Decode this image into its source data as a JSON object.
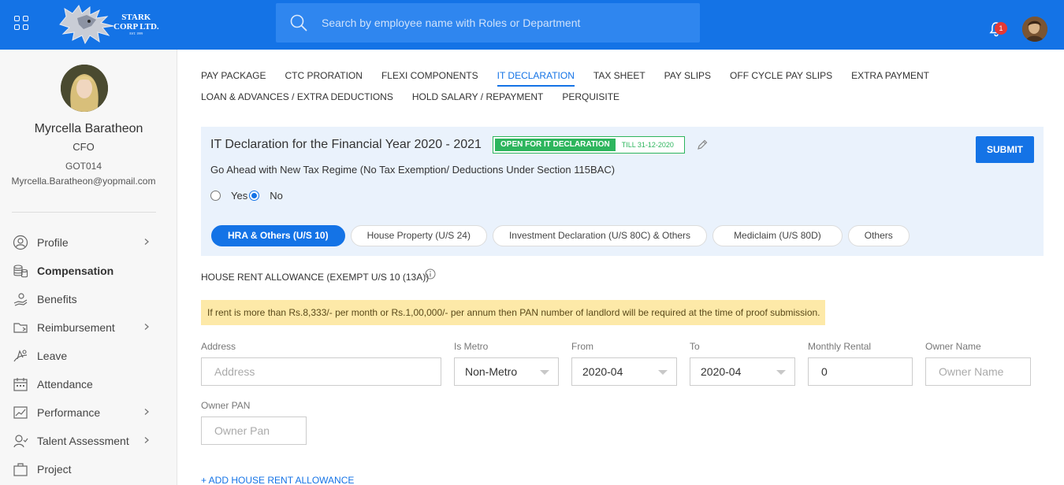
{
  "header": {
    "logo": {
      "line1": "STARK",
      "line2": "CORP LTD.",
      "est": "EST. 1999"
    },
    "search": {
      "placeholder": "Search by employee name with Roles or Department"
    },
    "notifications": {
      "count": "1"
    }
  },
  "profile": {
    "name": "Myrcella Baratheon",
    "role": "CFO",
    "code": "GOT014",
    "email": "Myrcella.Baratheon@yopmail.com"
  },
  "sidebar": {
    "items": [
      {
        "label": "Profile",
        "icon": "user-icon",
        "chevron": true
      },
      {
        "label": "Compensation",
        "icon": "coins-icon",
        "chevron": false,
        "active": true
      },
      {
        "label": "Benefits",
        "icon": "benefits-icon",
        "chevron": false
      },
      {
        "label": "Reimbursement",
        "icon": "folder-icon",
        "chevron": true
      },
      {
        "label": "Leave",
        "icon": "leave-icon",
        "chevron": false
      },
      {
        "label": "Attendance",
        "icon": "calendar-icon",
        "chevron": false
      },
      {
        "label": "Performance",
        "icon": "chart-icon",
        "chevron": true
      },
      {
        "label": "Talent Assessment",
        "icon": "assessment-icon",
        "chevron": true
      },
      {
        "label": "Project",
        "icon": "briefcase-icon",
        "chevron": false
      }
    ]
  },
  "tabs": {
    "row1": [
      "PAY PACKAGE",
      "CTC PRORATION",
      "FLEXI COMPONENTS",
      "IT DECLARATION",
      "TAX SHEET",
      "PAY SLIPS",
      "OFF CYCLE PAY SLIPS",
      "EXTRA PAYMENT"
    ],
    "row2": [
      "LOAN & ADVANCES / EXTRA DEDUCTIONS",
      "HOLD SALARY / REPAYMENT",
      "PERQUISITE"
    ],
    "active": "IT DECLARATION"
  },
  "declaration": {
    "title": "IT Declaration for the Financial Year 2020 - 2021",
    "status": "OPEN FOR IT DECLARATION",
    "till": "TILL 31-12-2020",
    "submit_label": "SUBMIT",
    "regime_question": "Go Ahead with New Tax Regime (No Tax Exemption/ Deductions Under Section 115BAC)",
    "yes_label": "Yes",
    "no_label": "No",
    "selected": "No",
    "sections": [
      "HRA & Others (U/S 10)",
      "House Property (U/S 24)",
      "Investment Declaration (U/S 80C) & Others",
      "Mediclaim (U/S 80D)",
      "Others"
    ],
    "active_section": "HRA & Others (U/S 10)"
  },
  "hra": {
    "title": "HOUSE RENT ALLOWANCE (EXEMPT U/S 10 (13A))",
    "notice": "If rent is more than Rs.8,333/- per month or Rs.1,00,000/- per annum then PAN number of landlord will be required at the time of proof submission.",
    "fields": {
      "address": {
        "label": "Address",
        "placeholder": "Address",
        "value": ""
      },
      "is_metro": {
        "label": "Is Metro",
        "value": "Non-Metro"
      },
      "from": {
        "label": "From",
        "value": "2020-04"
      },
      "to": {
        "label": "To",
        "value": "2020-04"
      },
      "monthly_rental": {
        "label": "Monthly Rental",
        "value": "0"
      },
      "owner_name": {
        "label": "Owner Name",
        "placeholder": "Owner Name",
        "value": ""
      },
      "owner_pan": {
        "label": "Owner PAN",
        "placeholder": "Owner Pan",
        "value": ""
      }
    },
    "add_label": "+ ADD HOUSE RENT ALLOWANCE"
  },
  "colors": {
    "primary": "#1473e6",
    "success": "#2db55d",
    "warning_bg": "#fde9a8",
    "panel_bg": "#eaf2fc"
  }
}
